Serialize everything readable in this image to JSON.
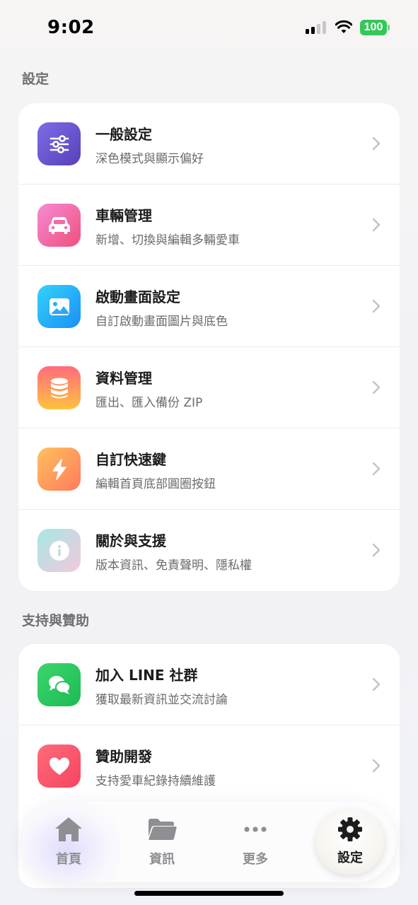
{
  "status_bar": {
    "time": "9:02",
    "battery": "100"
  },
  "sections": [
    {
      "title": "設定",
      "items": [
        {
          "title": "一般設定",
          "subtitle": "深色模式與顯示偏好",
          "icon": "sliders-icon",
          "gradient": [
            "#7b6ee6",
            "#5a3fb8"
          ]
        },
        {
          "title": "車輛管理",
          "subtitle": "新增、切換與編輯多輛愛車",
          "icon": "car-icon",
          "gradient": [
            "#f58bd6",
            "#f0507a"
          ]
        },
        {
          "title": "啟動畫面設定",
          "subtitle": "自訂啟動畫面圖片與底色",
          "icon": "image-icon",
          "gradient": [
            "#34d3fb",
            "#1a8ff6"
          ]
        },
        {
          "title": "資料管理",
          "subtitle": "匯出、匯入備份 ZIP",
          "icon": "database-icon",
          "gradient": [
            "#ff6b7d",
            "#ffc240"
          ]
        },
        {
          "title": "自訂快速鍵",
          "subtitle": "編輯首頁底部圓圈按鈕",
          "icon": "lightning-icon",
          "gradient": [
            "#ffc15e",
            "#ff7a5c"
          ]
        },
        {
          "title": "關於與支援",
          "subtitle": "版本資訊、免責聲明、隱私權",
          "icon": "info-icon",
          "gradient": [
            "#a6e8e4",
            "#f2c8dc"
          ]
        }
      ]
    },
    {
      "title": "支持與贊助",
      "items": [
        {
          "title": "加入 LINE 社群",
          "subtitle": "獲取最新資訊並交流討論",
          "icon": "chat-icon",
          "gradient": [
            "#3ad66c",
            "#1fba55"
          ]
        },
        {
          "title": "贊助開發",
          "subtitle": "支持愛車紀錄持續維護",
          "icon": "heart-icon",
          "gradient": [
            "#ff6b7a",
            "#f54561"
          ]
        }
      ]
    }
  ],
  "tab_bar": {
    "tabs": [
      {
        "label": "首頁",
        "icon": "home-icon"
      },
      {
        "label": "資訊",
        "icon": "folder-icon"
      },
      {
        "label": "更多",
        "icon": "more-icon"
      },
      {
        "label": "設定",
        "icon": "gear-icon",
        "active": true
      }
    ]
  }
}
